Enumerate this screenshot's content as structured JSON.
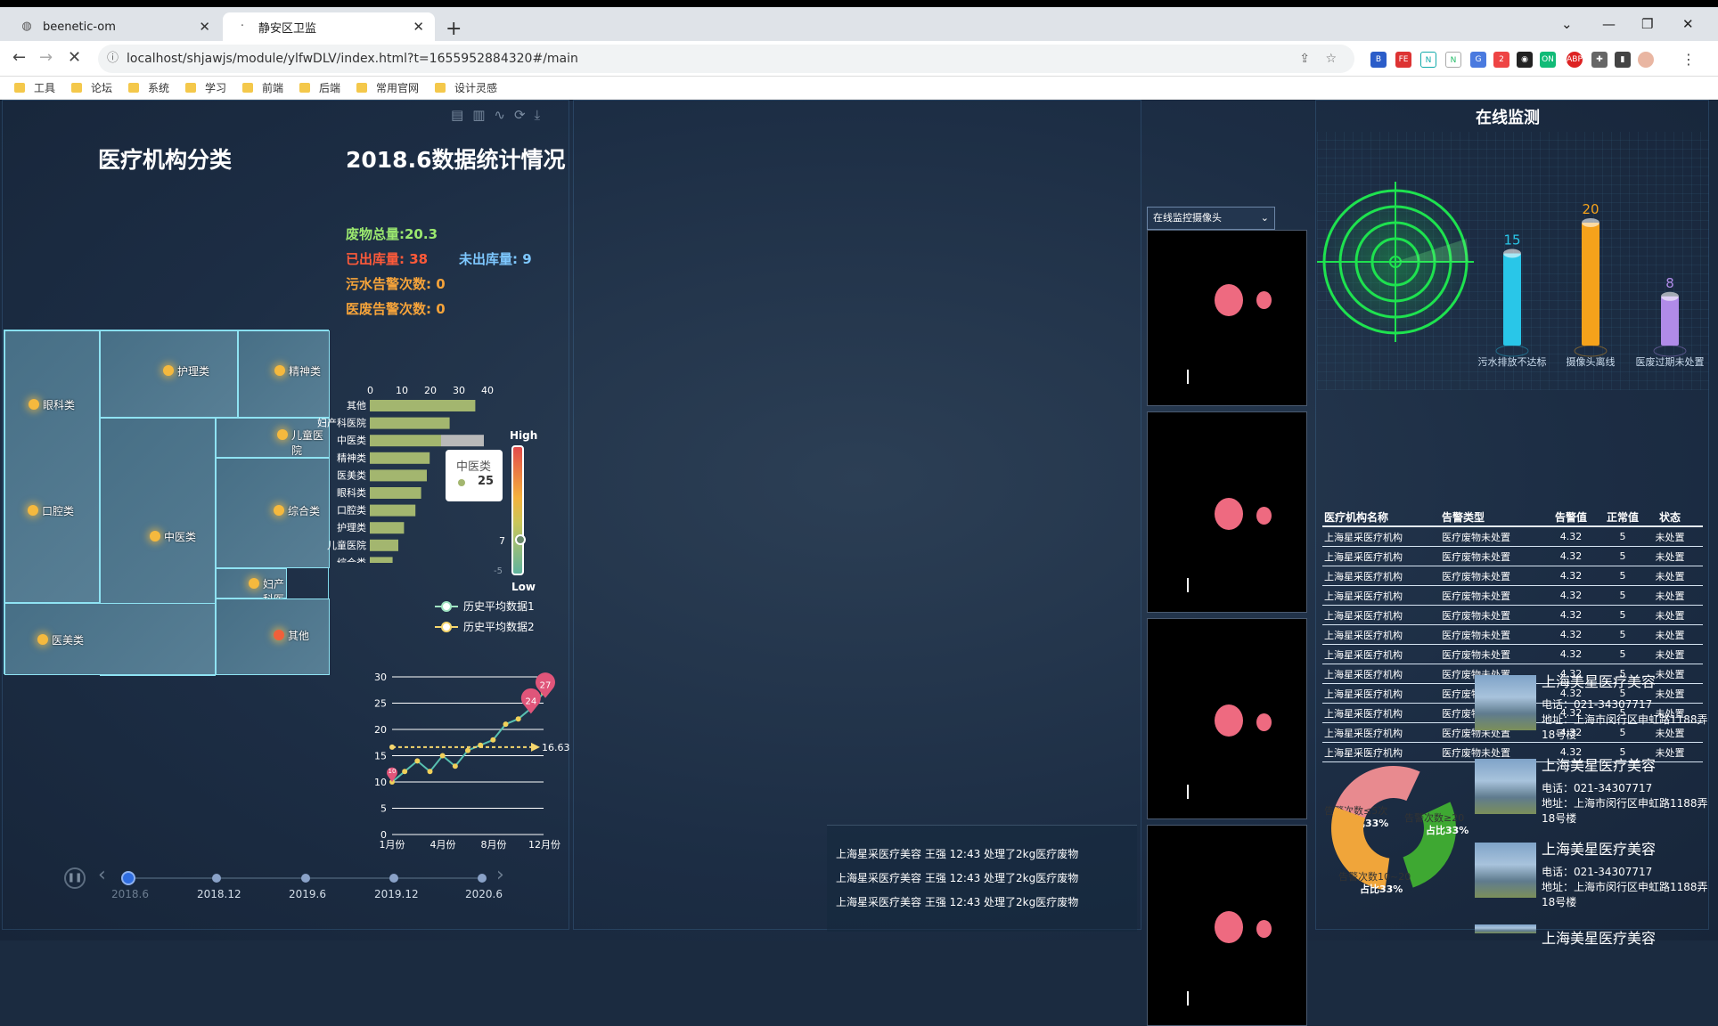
{
  "browser": {
    "tabs": [
      {
        "title": "beenetic-om",
        "active": false
      },
      {
        "title": "静安区卫监",
        "active": true
      }
    ],
    "url": "localhost/shjawjs/module/ylfwDLV/index.html?t=1655952884320#/main",
    "bookmarks": [
      "工具",
      "论坛",
      "系统",
      "学习",
      "前端",
      "后端",
      "常用官网",
      "设计灵感"
    ]
  },
  "left": {
    "title_category": "医疗机构分类",
    "title_stats": "2018.6数据统计情况",
    "stats": {
      "waste_total_label": "废物总量:",
      "waste_total": "20.3",
      "out_label": "已出库量:",
      "out_value": "38",
      "not_out_label": "未出库量:",
      "not_out_value": "9",
      "sewage_label": "污水告警次数:",
      "sewage_value": "0",
      "medwaste_label": "医废告警次数:",
      "medwaste_value": "0"
    },
    "treemap": [
      "护理类",
      "精神类",
      "眼科类",
      "儿童医院",
      "口腔类",
      "中医类",
      "综合类",
      "妇产科医院",
      "医美类",
      "其他"
    ],
    "hbar": {
      "type": "bar",
      "categories": [
        "其他",
        "妇产科医院",
        "中医类",
        "精神类",
        "医美类",
        "眼科类",
        "口腔类",
        "护理类",
        "儿童医院",
        "综合类"
      ],
      "values": [
        37,
        28,
        25,
        21,
        20,
        18,
        16,
        12,
        10,
        8
      ],
      "xticks": [
        "0",
        "10",
        "20",
        "30",
        "40"
      ]
    },
    "visualmap": {
      "high": "High",
      "low": "Low",
      "value_label": "7",
      "low_value": "-5"
    },
    "tooltip": {
      "name": "中医类",
      "value": "25"
    },
    "line": {
      "type": "line",
      "legend": [
        "历史平均数据1",
        "历史平均数据2"
      ],
      "yticks": [
        "30",
        "25",
        "20",
        "15",
        "10",
        "5",
        "0"
      ],
      "xticks": [
        "1月份",
        "4月份",
        "8月份",
        "12月份"
      ],
      "series1": [
        10,
        12,
        14,
        12,
        15,
        13,
        16,
        17,
        18,
        21,
        22,
        24,
        27
      ],
      "series2": [
        16.63
      ],
      "markpoints": [
        "27",
        "24",
        "10"
      ],
      "markline": "16.63"
    },
    "timeline": [
      "2018.6",
      "2018.12",
      "2019.6",
      "2019.12",
      "2020.6"
    ]
  },
  "logs": [
    "上海星采医疗美容 王强 12:43 处理了2kg医疗废物",
    "上海星采医疗美容 王强 12:43 处理了2kg医疗废物",
    "上海星采医疗美容 王强 12:43 处理了2kg医疗废物"
  ],
  "camera": {
    "select": "在线监控摄像头"
  },
  "monitor": {
    "title": "在线监测",
    "bars": [
      {
        "label": "污水排放不达标",
        "value": 15,
        "color": "#29c6e8"
      },
      {
        "label": "摄像头离线",
        "value": 20,
        "color": "#f5a21b"
      },
      {
        "label": "医废过期未处置",
        "value": 8,
        "color": "#b08be8"
      }
    ]
  },
  "table": {
    "headers": [
      "医疗机构名称",
      "告警类型",
      "告警值",
      "正常值",
      "状态"
    ],
    "row": [
      "上海星采医疗机构",
      "医疗废物未处置",
      "4.32",
      "5",
      "未处置"
    ],
    "count": 12
  },
  "pie": {
    "type": "pie",
    "slices": [
      {
        "label": "告警次数≤5次",
        "pct": "占比33%",
        "color": "#e88a8f"
      },
      {
        "label": "告警次数≥20",
        "pct": "占比33%",
        "color": "#3ea832"
      },
      {
        "label": "告警次数10~20",
        "pct": "占比33%",
        "color": "#f0a53a"
      }
    ]
  },
  "places": [
    {
      "name": "上海美星医疗美容",
      "phone": "电话：021-34307717",
      "addr": "地址：上海市闵行区申虹路1188弄18号楼"
    },
    {
      "name": "上海美星医疗美容",
      "phone": "电话：021-34307717",
      "addr": "地址：上海市闵行区申虹路1188弄18号楼"
    },
    {
      "name": "上海美星医疗美容",
      "phone": "电话：021-34307717",
      "addr": "地址：上海市闵行区申虹路1188弄18号楼"
    },
    {
      "name": "上海美星医疗美容"
    }
  ]
}
